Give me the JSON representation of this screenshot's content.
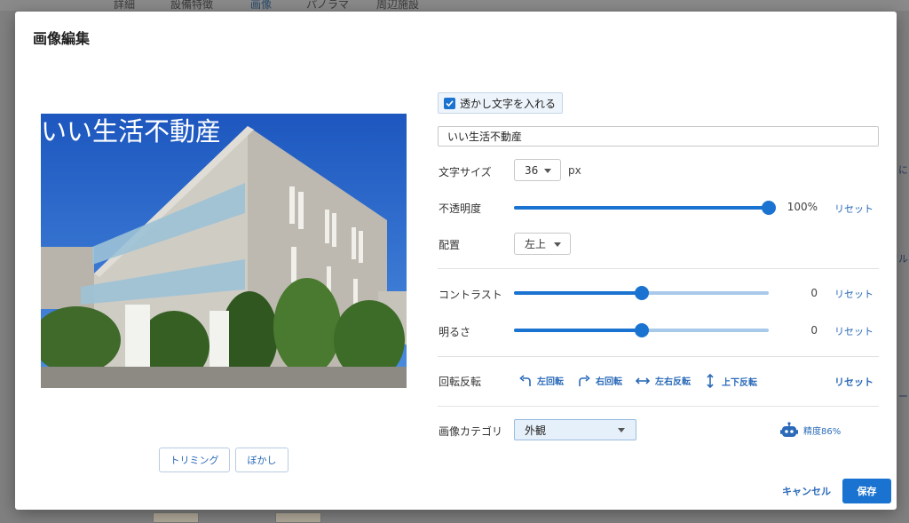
{
  "background": {
    "tabs": [
      "詳細",
      "設備特徴",
      "画像",
      "パノラマ",
      "周辺施設"
    ],
    "active_tab_index": 2,
    "right_fragments": [
      "に",
      "ドル",
      "ー"
    ]
  },
  "modal": {
    "title": "画像編集",
    "preview": {
      "watermark_text": "いい生活不動産",
      "buttons": {
        "trim": "トリミング",
        "blur": "ぼかし"
      }
    },
    "watermark": {
      "checkbox_label": "透かし文字を入れる",
      "checked": true,
      "text_value": "いい生活不動産"
    },
    "font_size": {
      "label": "文字サイズ",
      "value": "36",
      "unit": "px"
    },
    "opacity": {
      "label": "不透明度",
      "value_text": "100%",
      "fraction": 1.0,
      "reset": "リセット"
    },
    "placement": {
      "label": "配置",
      "value": "左上"
    },
    "contrast": {
      "label": "コントラスト",
      "value_text": "0",
      "fraction": 0.5,
      "reset": "リセット"
    },
    "brightness": {
      "label": "明るさ",
      "value_text": "0",
      "fraction": 0.5,
      "reset": "リセット"
    },
    "rotation": {
      "label": "回転反転",
      "rotate_left": "左回転",
      "rotate_right": "右回転",
      "flip_horizontal": "左右反転",
      "flip_vertical": "上下反転",
      "reset": "リセット"
    },
    "category": {
      "label": "画像カテゴリ",
      "value": "外観",
      "accuracy": "精度86%"
    },
    "footer": {
      "cancel": "キャンセル",
      "save": "保存"
    }
  },
  "colors": {
    "accent": "#1a73d0",
    "link": "#2a6ab8",
    "track_light": "#a8c9ea"
  }
}
